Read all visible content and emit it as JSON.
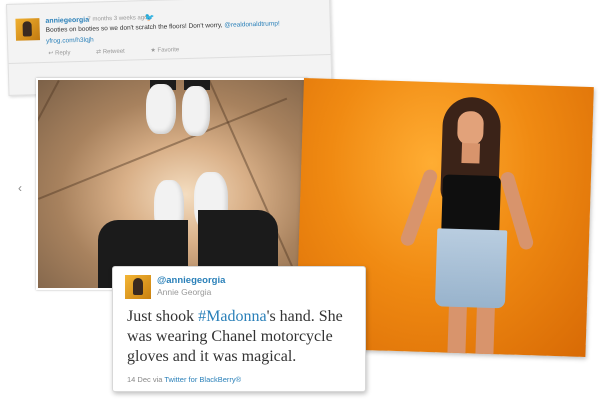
{
  "top_tweet": {
    "username": "anniegeorgia",
    "time": "7 months 3 weeks ago",
    "text_main": "Booties on booties so we don't scratch the floors! Don't worry, ",
    "mention": "@realdonaldtrump!",
    "short_link": "yfrog.com/h3lqjh",
    "actions": [
      "Reply",
      "Retweet",
      "Favorite"
    ],
    "bird_icon": "twitter-bird-icon"
  },
  "carousel": {
    "prev_symbol": "‹"
  },
  "featured_tweet": {
    "handle": "@anniegeorgia",
    "display_name": "Annie Georgia",
    "text_before": "Just shook ",
    "hashtag": "#Madonna",
    "text_after": "'s hand. She was wearing Chanel motorcycle gloves and it was magical.",
    "date": "14 Dec",
    "via_text": " via ",
    "client": "Twitter for BlackBerry®"
  },
  "colors": {
    "link": "#2a80b9",
    "orange_bg": "#f08a12"
  }
}
